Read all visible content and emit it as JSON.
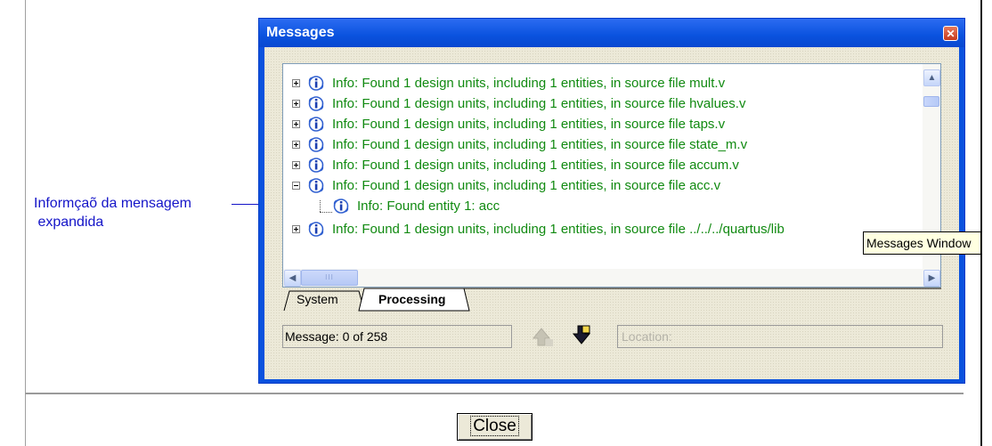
{
  "window": {
    "title": "Messages",
    "close_glyph": "✕"
  },
  "annotation": {
    "text": "Informçaõ da mensagem\n expandida"
  },
  "messages": [
    {
      "text": "Info: Found 1 design units, including 1 entities, in source file mult.v",
      "expander": "plus"
    },
    {
      "text": "Info: Found 1 design units, including 1 entities, in source file hvalues.v",
      "expander": "plus"
    },
    {
      "text": "Info: Found 1 design units, including 1 entities, in source file taps.v",
      "expander": "plus"
    },
    {
      "text": "Info: Found 1 design units, including 1 entities, in source file state_m.v",
      "expander": "plus"
    },
    {
      "text": "Info: Found 1 design units, including 1 entities, in source file accum.v",
      "expander": "plus"
    },
    {
      "text": "Info: Found 1 design units, including 1 entities, in source file acc.v",
      "expander": "minus"
    },
    {
      "text": "Info: Found entity 1: acc",
      "expander": "none"
    },
    {
      "text": "Info: Found 1 design units, including 1 entities, in source file ../../../quartus/lib",
      "expander": "plus"
    }
  ],
  "tabs": [
    {
      "label": "System",
      "active": false
    },
    {
      "label": "Processing",
      "active": true
    }
  ],
  "status": {
    "message": "Message: 0 of 258",
    "location_placeholder": "Location:"
  },
  "tooltip": {
    "text": "Messages Window"
  },
  "close_button": {
    "label": "Close"
  },
  "colors": {
    "message_text": "#118a11",
    "annotation": "#1414c8",
    "titlebar": "#0a52de",
    "tooltip_bg": "#ffffe1"
  },
  "icons": {
    "message": "info-icon",
    "up": "previous-message-icon",
    "down": "next-message-icon"
  }
}
